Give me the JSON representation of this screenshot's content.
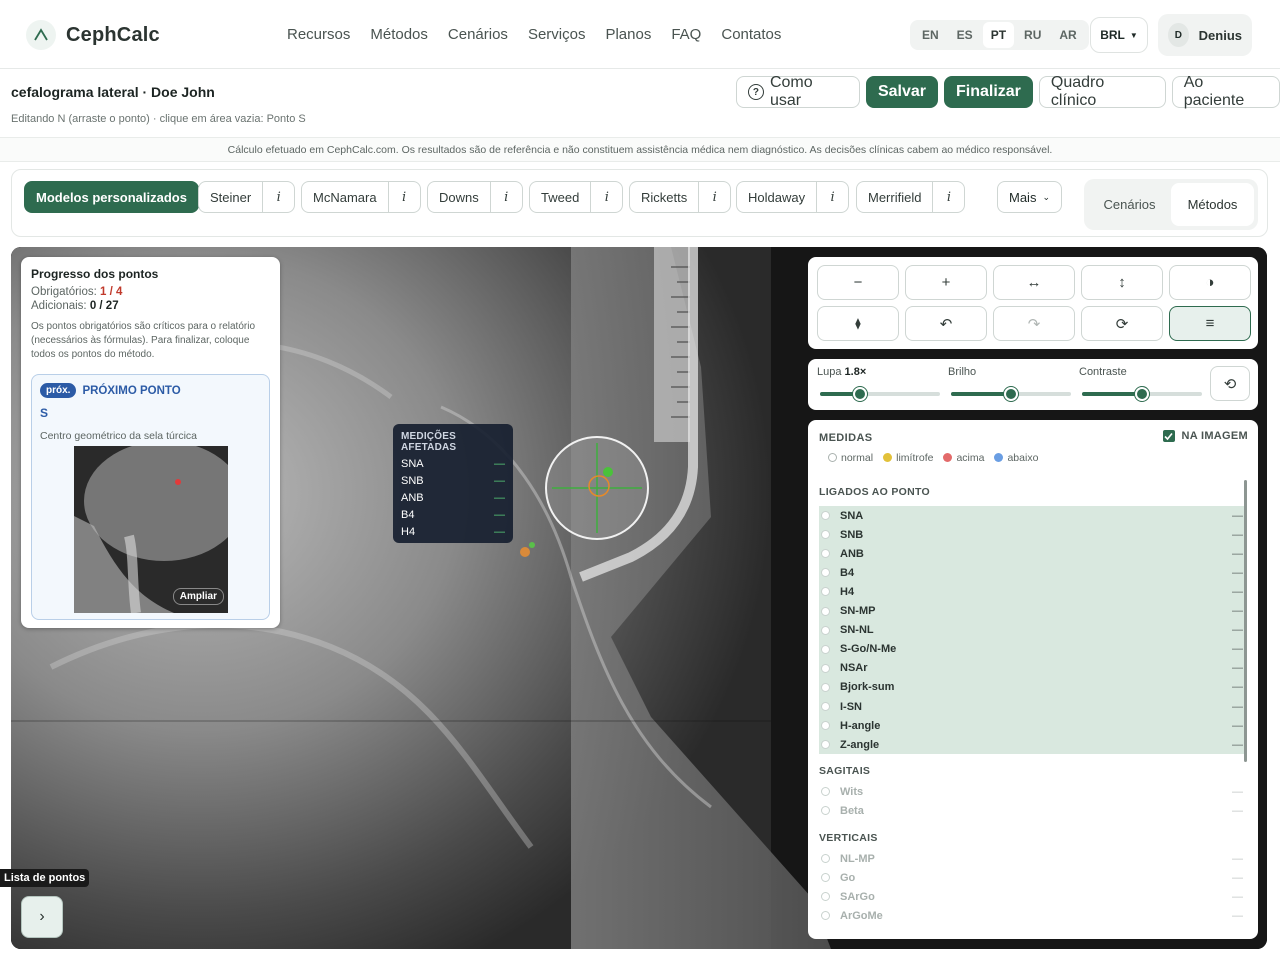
{
  "brand": {
    "name": "CephCalc"
  },
  "nav": [
    "Recursos",
    "Métodos",
    "Cenários",
    "Serviços",
    "Planos",
    "FAQ",
    "Contatos"
  ],
  "languages": {
    "items": [
      "EN",
      "ES",
      "PT",
      "RU",
      "AR"
    ],
    "active": "PT"
  },
  "currency": "BRL",
  "user": {
    "initial": "D",
    "name": "Denius"
  },
  "header": {
    "title": "cefalograma lateral · Doe John",
    "subtitle": "Editando N (arraste o ponto) · clique em área vazia: Ponto S"
  },
  "actions": {
    "how_to": "Como usar",
    "save": "Salvar",
    "finish": "Finalizar",
    "clinical": "Quadro clínico",
    "patient": "Ao paciente"
  },
  "disclaimer": "Cálculo efetuado em CephCalc.com. Os resultados são de referência e não constituem assistência médica nem diagnóstico. As decisões clínicas cabem ao médico responsável.",
  "methods": {
    "custom": "Modelos personalizados",
    "items": [
      "Steiner",
      "McNamara",
      "Downs",
      "Tweed",
      "Ricketts",
      "Holdaway",
      "Merrifield"
    ],
    "info": "i",
    "more": "Mais",
    "tabs": [
      "Cenários",
      "Métodos"
    ],
    "active_tab": "Métodos"
  },
  "progress": {
    "title": "Progresso dos pontos",
    "required_label": "Obrigatórios:",
    "required_value": "1 / 4",
    "additional_label": "Adicionais:",
    "additional_value": "0 / 27",
    "description": "Os pontos obrigatórios são críticos para o relatório (necessários às fórmulas). Para finalizar, coloque todos os pontos do método.",
    "next_badge": "próx.",
    "next_label": "PRÓXIMO PONTO",
    "next_point": "S",
    "next_desc": "Centro geométrico da sela túrcica",
    "expand": "Ampliar"
  },
  "affected": {
    "title": "MEDIÇÕES AFETADAS",
    "rows": [
      {
        "name": "SNA",
        "value": "—"
      },
      {
        "name": "SNB",
        "value": "—"
      },
      {
        "name": "ANB",
        "value": "—"
      },
      {
        "name": "B4",
        "value": "—"
      },
      {
        "name": "H4",
        "value": "—"
      }
    ]
  },
  "points_list": {
    "label": "Lista de pontos"
  },
  "tools": {
    "zoom_out": "−",
    "zoom_in": "+",
    "flip_h": "↔",
    "flip_v": "↕",
    "invert": "◑",
    "marker": "⧫",
    "undo": "↶",
    "redo": "↷",
    "rotate": "⟳",
    "settings": "≡"
  },
  "sliders": {
    "lupa_label": "Lupa",
    "lupa_value": "1.8×",
    "lupa_level": 0.33,
    "brightness_label": "Brilho",
    "brightness_level": 0.5,
    "contrast_label": "Contraste",
    "contrast_level": 0.5
  },
  "measures": {
    "title": "MEDIDAS",
    "on_image": "NA IMAGEM",
    "legend": [
      {
        "label": "normal",
        "color": "#ffffff"
      },
      {
        "label": "limítrofe",
        "color": "#e2c13a"
      },
      {
        "label": "acima",
        "color": "#e36a6a"
      },
      {
        "label": "abaixo",
        "color": "#6a9ee3"
      }
    ],
    "linked_title": "LIGADOS AO PONTO",
    "linked": [
      {
        "name": "SNA",
        "value": "—"
      },
      {
        "name": "SNB",
        "value": "—"
      },
      {
        "name": "ANB",
        "value": "—"
      },
      {
        "name": "B4",
        "value": "—"
      },
      {
        "name": "H4",
        "value": "—"
      },
      {
        "name": "SN-MP",
        "value": "—"
      },
      {
        "name": "SN-NL",
        "value": "—"
      },
      {
        "name": "S-Go/N-Me",
        "value": "—"
      },
      {
        "name": "NSAr",
        "value": "—"
      },
      {
        "name": "Bjork-sum",
        "value": "—"
      },
      {
        "name": "I-SN",
        "value": "—"
      },
      {
        "name": "H-angle",
        "value": "—"
      },
      {
        "name": "Z-angle",
        "value": "—"
      }
    ],
    "sagittal_title": "SAGITAIS",
    "sagittal": [
      {
        "name": "Wits",
        "value": "—"
      },
      {
        "name": "Beta",
        "value": "—"
      }
    ],
    "vertical_title": "VERTICAIS",
    "vertical": [
      {
        "name": "NL-MP",
        "value": "—"
      },
      {
        "name": "Go",
        "value": "—"
      },
      {
        "name": "SArGo",
        "value": "—"
      },
      {
        "name": "ArGoMe",
        "value": "—"
      }
    ]
  }
}
